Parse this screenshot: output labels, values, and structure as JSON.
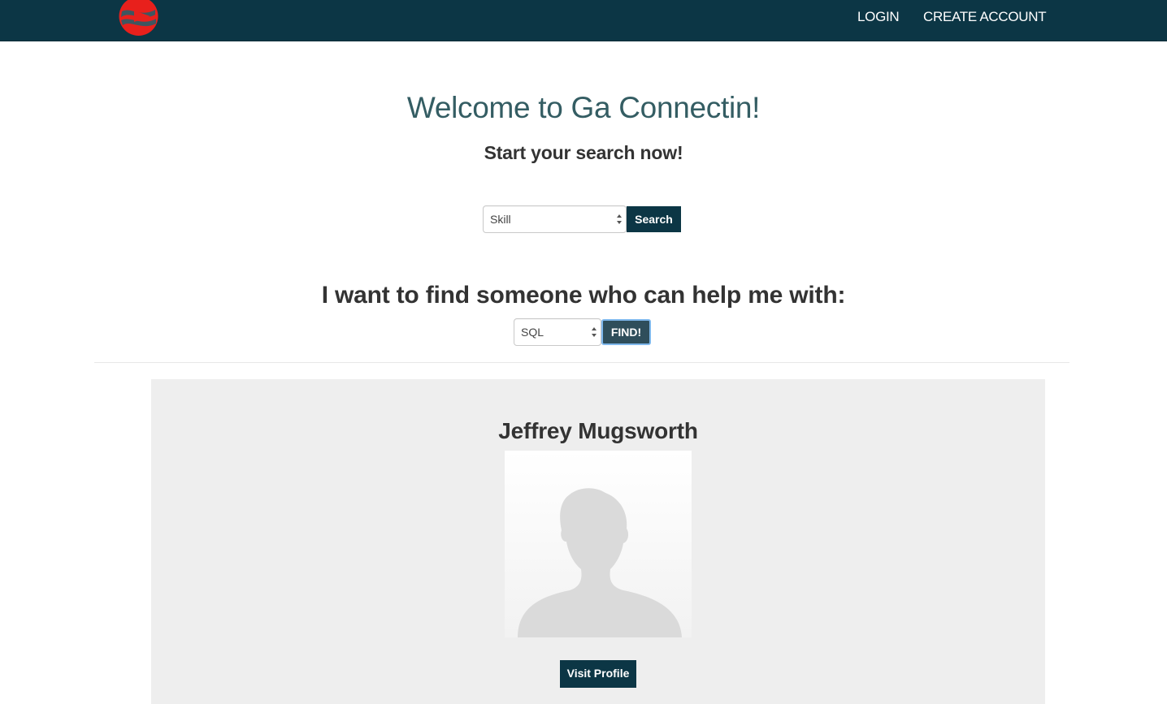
{
  "nav": {
    "login_label": "LOGIN",
    "create_account_label": "CREATE ACCOUNT"
  },
  "hero": {
    "title": "Welcome to Ga Connectin!",
    "subtitle": "Start your search now!"
  },
  "search": {
    "select_value": "Skill",
    "button_label": "Search"
  },
  "help": {
    "heading": "I want to find someone who can help me with:",
    "select_value": "SQL",
    "button_label": "FIND!"
  },
  "result": {
    "name": "Jeffrey Mugsworth",
    "button_label": "Visit Profile"
  },
  "icons": {
    "logo": "logo-icon",
    "select_arrows": "select-arrows-icon",
    "avatar": "avatar-placeholder-icon"
  },
  "colors": {
    "navbar": "#0c3645",
    "title": "#345d63",
    "primary_button": "#0c3645",
    "find_button": "#2f4e5b",
    "card_background": "#eeeeee",
    "logo_red": "#e8201c"
  }
}
